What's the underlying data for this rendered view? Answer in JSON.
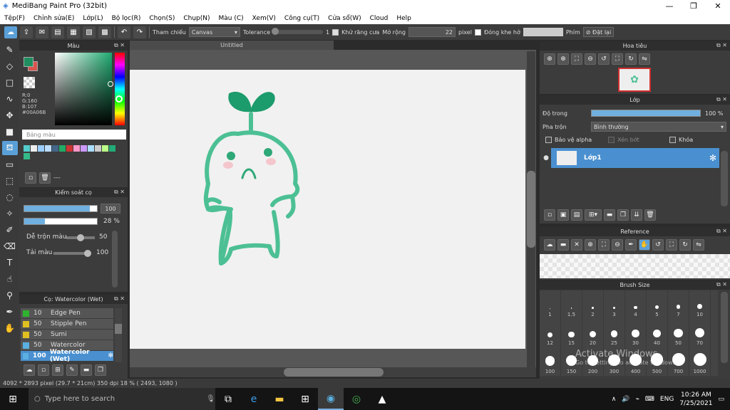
{
  "window": {
    "title": "MediBang Paint Pro (32bit)"
  },
  "menu": [
    "Tệp(F)",
    "Chỉnh sửa(E)",
    "Lớp(L)",
    "Bộ lọc(R)",
    "Chọn(S)",
    "Chụp(N)",
    "Màu (C)",
    "Xem(V)",
    "Công cụ(T)",
    "Cửa sổ(W)",
    "Cloud",
    "Help"
  ],
  "toolbar": {
    "ref_label": "Tham chiếu",
    "ref_value": "Canvas",
    "tolerance_label": "Tolerance",
    "tolerance_value": "1",
    "antialias_label": "Khử răng cưa",
    "expand_label": "Mở rộng",
    "expand_value": "22",
    "expand_unit": "pixel",
    "close_gap_label": "Đóng khe hở",
    "key_label": "Phím",
    "reset_label": "Đặt lại"
  },
  "color_panel": {
    "title": "Màu",
    "r": "R:0",
    "g": "G:160",
    "b": "B:107",
    "hex": "#00A06B",
    "palette_label": "Bảng màu",
    "palette_dash": "---",
    "primary_color": "#1f8f5f",
    "secondary_color": "#d9534f"
  },
  "brush_control": {
    "title": "Kiểm soát cọ",
    "size_value": "100",
    "opacity_value": "28 %",
    "size_fill": 0.9,
    "opacity_fill": 0.28,
    "blend_label": "Dễ trộn màu",
    "blend_value": "50",
    "blend_fill": 0.5,
    "reload_label": "Tải màu",
    "reload_value": "100",
    "reload_fill": 1.0
  },
  "brush_panel": {
    "title": "Cọ: Watercolor (Wet)",
    "items": [
      {
        "size": "10",
        "name": "Edge Pen",
        "color": "#2db32d"
      },
      {
        "size": "50",
        "name": "Stipple Pen",
        "color": "#e0c020"
      },
      {
        "size": "50",
        "name": "Sumi",
        "color": "#e0c020"
      },
      {
        "size": "50",
        "name": "Watercolor",
        "color": "#5ab0e0"
      },
      {
        "size": "100",
        "name": "Watercolor (Wet)",
        "color": "#5ab0e0"
      }
    ]
  },
  "document": {
    "tab": "Untitled"
  },
  "navigator": {
    "title": "Hoa tiêu"
  },
  "layer_panel": {
    "title": "Lớp",
    "opacity_label": "Độ trong",
    "opacity_value": "100 %",
    "opacity_fill": 1.0,
    "blend_label": "Pha trộn",
    "blend_value": "Bình thường",
    "protect_alpha": "Bảo vệ alpha",
    "clipping": "Xén bớt",
    "lock": "Khóa",
    "layer_name": "Lớp1"
  },
  "reference_panel": {
    "title": "Reference"
  },
  "brush_size_panel": {
    "title": "Brush Size",
    "sizes_row1": [
      "1",
      "1.5",
      "2",
      "3",
      "4",
      "5",
      "7",
      "10"
    ],
    "sizes_row2": [
      "12",
      "15",
      "20",
      "25",
      "30",
      "40",
      "50",
      "70"
    ],
    "sizes_row3": [
      "100",
      "150",
      "200",
      "300",
      "400",
      "500",
      "700",
      "1000"
    ],
    "watermark1": "Activate Windows",
    "watermark2": "Go to Settings to activate Windows."
  },
  "statusbar": {
    "text": "4092 * 2893 pixel   (29.7 * 21cm)   350 dpi   18 %   ( 2493, 1080 )"
  },
  "taskbar": {
    "search_placeholder": "Type here to search",
    "lang": "ENG",
    "time": "10:26 AM",
    "date": "7/25/2021"
  }
}
